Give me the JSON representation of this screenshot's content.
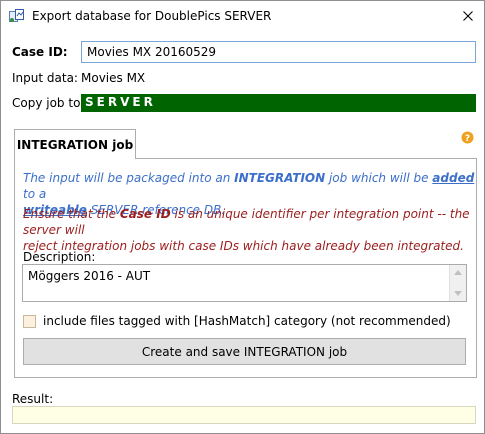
{
  "window": {
    "title": "Export database for DoublePics SERVER",
    "close_glyph": "✕"
  },
  "form": {
    "case_id_label": "Case ID:",
    "case_id_value": "Movies MX 20160529",
    "input_data_label": "Input data:",
    "input_data_value": "Movies MX",
    "copy_job_label": "Copy job to:",
    "copy_job_value": "SERVER",
    "copy_job_color": "#006400"
  },
  "tab": {
    "label": "INTEGRATION job",
    "help_glyph": "?",
    "info": {
      "p1_a": "The input will be packaged into an ",
      "p1_b": "INTEGRATION",
      "p1_c": " job which will be ",
      "p1_d": "added",
      "p1_e": " to a",
      "p1_f": "writeable",
      "p1_g": " SERVER reference DB.",
      "p2_a": "Ensure that the ",
      "p2_b": "Case ID",
      "p2_c": " is an unique identifier per integration point -- the server will",
      "p2_d": "reject integration jobs with case IDs which have already been integrated."
    },
    "description_label": "Description:",
    "description_value": "Möggers 2016 - AUT",
    "checkbox_label": "include files tagged with [HashMatch] category (not recommended)",
    "checkbox_checked": false,
    "create_button": "Create and save INTEGRATION job"
  },
  "result": {
    "label": "Result:",
    "value": ""
  },
  "colors": {
    "info_blue": "#3c6fc9",
    "warning_red": "#9b1c1c",
    "result_bg": "#ffffe6"
  }
}
